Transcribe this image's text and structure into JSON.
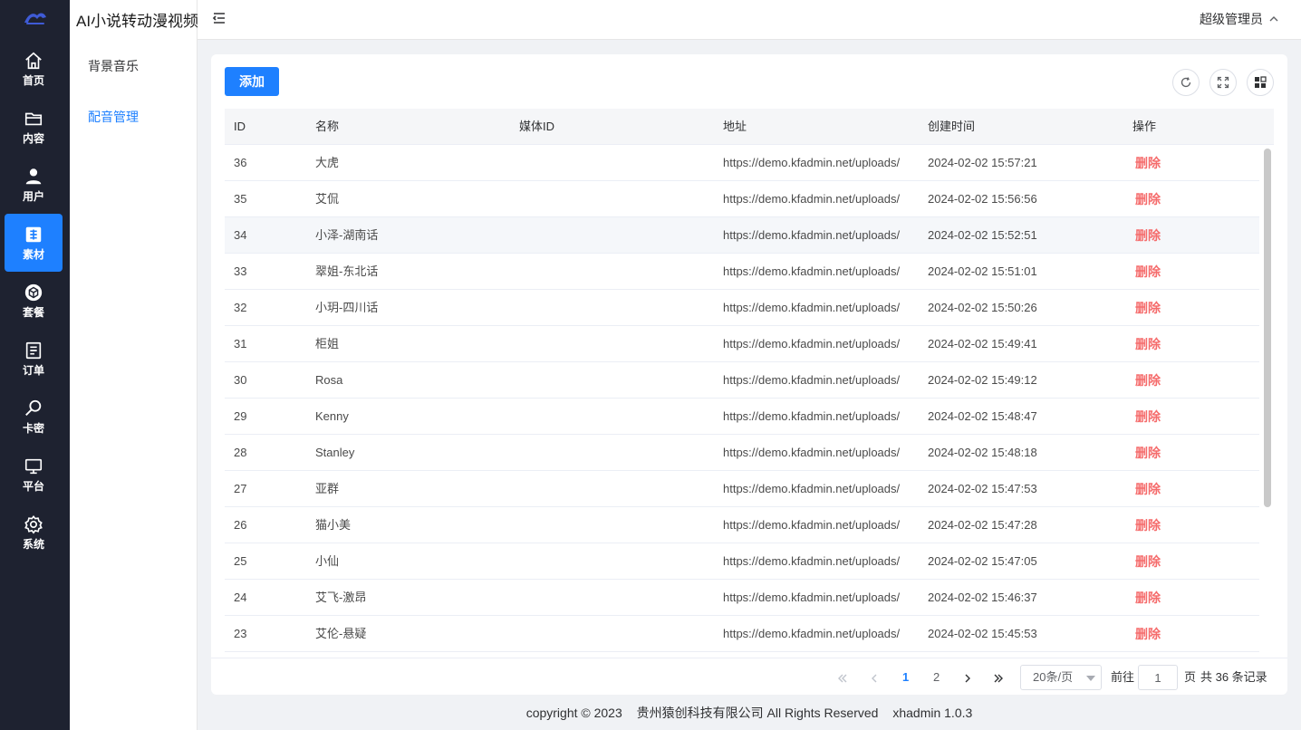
{
  "app_title": "AI小说转动漫视频",
  "rail": [
    {
      "label": "首页",
      "icon": "home-icon"
    },
    {
      "label": "内容",
      "icon": "folder-icon"
    },
    {
      "label": "用户",
      "icon": "user-icon"
    },
    {
      "label": "素材",
      "icon": "material-icon",
      "active": true
    },
    {
      "label": "套餐",
      "icon": "package-icon"
    },
    {
      "label": "订单",
      "icon": "order-icon"
    },
    {
      "label": "卡密",
      "icon": "key-icon"
    },
    {
      "label": "平台",
      "icon": "monitor-icon"
    },
    {
      "label": "系统",
      "icon": "gear-icon"
    }
  ],
  "submenu": [
    {
      "label": "背景音乐"
    },
    {
      "label": "配音管理",
      "active": true
    }
  ],
  "header": {
    "user": "超级管理员"
  },
  "toolbar": {
    "add_label": "添加"
  },
  "table": {
    "columns": [
      "ID",
      "名称",
      "媒体ID",
      "地址",
      "创建时间",
      "操作"
    ],
    "rows": [
      {
        "id": "36",
        "name": "大虎",
        "media_id": "",
        "url": "https://demo.kfadmin.net/uploads/",
        "created": "2024-02-02 15:57:21",
        "action": "删除"
      },
      {
        "id": "35",
        "name": "艾侃",
        "media_id": "",
        "url": "https://demo.kfadmin.net/uploads/",
        "created": "2024-02-02 15:56:56",
        "action": "删除"
      },
      {
        "id": "34",
        "name": "小泽-湖南话",
        "media_id": "",
        "url": "https://demo.kfadmin.net/uploads/",
        "created": "2024-02-02 15:52:51",
        "action": "删除"
      },
      {
        "id": "33",
        "name": "翠姐-东北话",
        "media_id": "",
        "url": "https://demo.kfadmin.net/uploads/",
        "created": "2024-02-02 15:51:01",
        "action": "删除"
      },
      {
        "id": "32",
        "name": "小玥-四川话",
        "media_id": "",
        "url": "https://demo.kfadmin.net/uploads/",
        "created": "2024-02-02 15:50:26",
        "action": "删除"
      },
      {
        "id": "31",
        "name": "柜姐",
        "media_id": "",
        "url": "https://demo.kfadmin.net/uploads/",
        "created": "2024-02-02 15:49:41",
        "action": "删除"
      },
      {
        "id": "30",
        "name": "Rosa",
        "media_id": "",
        "url": "https://demo.kfadmin.net/uploads/",
        "created": "2024-02-02 15:49:12",
        "action": "删除"
      },
      {
        "id": "29",
        "name": "Kenny",
        "media_id": "",
        "url": "https://demo.kfadmin.net/uploads/",
        "created": "2024-02-02 15:48:47",
        "action": "删除"
      },
      {
        "id": "28",
        "name": "Stanley",
        "media_id": "",
        "url": "https://demo.kfadmin.net/uploads/",
        "created": "2024-02-02 15:48:18",
        "action": "删除"
      },
      {
        "id": "27",
        "name": "亚群",
        "media_id": "",
        "url": "https://demo.kfadmin.net/uploads/",
        "created": "2024-02-02 15:47:53",
        "action": "删除"
      },
      {
        "id": "26",
        "name": "猫小美",
        "media_id": "",
        "url": "https://demo.kfadmin.net/uploads/",
        "created": "2024-02-02 15:47:28",
        "action": "删除"
      },
      {
        "id": "25",
        "name": "小仙",
        "media_id": "",
        "url": "https://demo.kfadmin.net/uploads/",
        "created": "2024-02-02 15:47:05",
        "action": "删除"
      },
      {
        "id": "24",
        "name": "艾飞-激昂",
        "media_id": "",
        "url": "https://demo.kfadmin.net/uploads/",
        "created": "2024-02-02 15:46:37",
        "action": "删除"
      },
      {
        "id": "23",
        "name": "艾伦-悬疑",
        "media_id": "",
        "url": "https://demo.kfadmin.net/uploads/",
        "created": "2024-02-02 15:45:53",
        "action": "删除"
      }
    ]
  },
  "pagination": {
    "pages": [
      "1",
      "2"
    ],
    "current": "1",
    "page_size": "20条/页",
    "goto_prefix": "前往",
    "goto_value": "1",
    "goto_suffix": "页",
    "total": "共 36 条记录"
  },
  "footer": {
    "copyright": "copyright © 2023",
    "company": "贵州猿创科技有限公司 All Rights Reserved",
    "version": "xhadmin 1.0.3"
  },
  "colors": {
    "primary": "#1e80ff",
    "danger": "#f56c6c",
    "rail_bg": "#1e2230"
  }
}
